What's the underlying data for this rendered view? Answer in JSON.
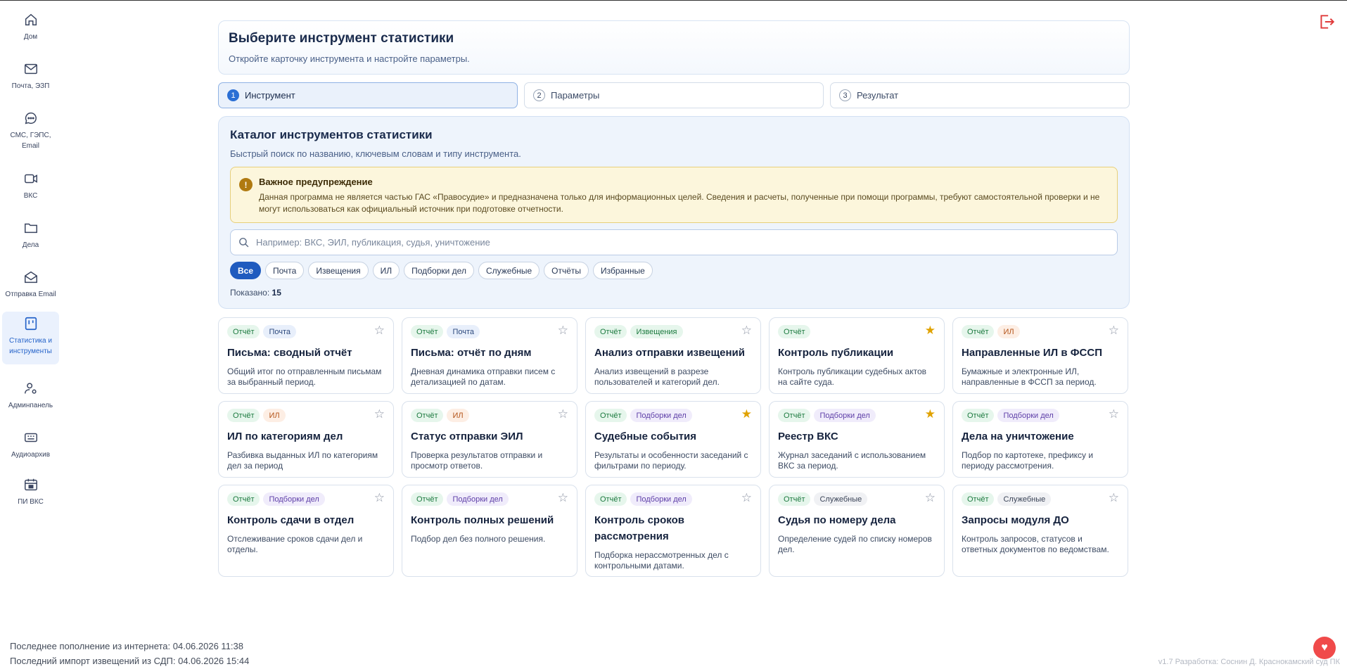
{
  "sidebar": {
    "items": [
      {
        "label": "Дом",
        "icon": "home-icon"
      },
      {
        "label": "Почта, ЭЗП",
        "icon": "mail-icon"
      },
      {
        "label": "СМС, ГЭПС, Email",
        "icon": "chat-icon"
      },
      {
        "label": "ВКС",
        "icon": "video-icon"
      },
      {
        "label": "Дела",
        "icon": "folder-icon"
      },
      {
        "label": "Отправка Email",
        "icon": "envelope-open-icon"
      },
      {
        "label": "Статистика и инструменты",
        "icon": "stats-icon",
        "active": true
      },
      {
        "label": "Админпанель",
        "icon": "user-gear-icon"
      },
      {
        "label": "Аудиоархив",
        "icon": "audio-icon"
      },
      {
        "label": "ПИ ВКС",
        "icon": "calendar-icon"
      }
    ]
  },
  "header": {
    "title": "Выберите инструмент статистики",
    "subtitle": "Откройте карточку инструмента и настройте параметры."
  },
  "steps": [
    {
      "num": "1",
      "label": "Инструмент",
      "active": true
    },
    {
      "num": "2",
      "label": "Параметры"
    },
    {
      "num": "3",
      "label": "Результат"
    }
  ],
  "catalog": {
    "title": "Каталог инструментов статистики",
    "subtitle": "Быстрый поиск по названию, ключевым словам и типу инструмента.",
    "warning_title": "Важное предупреждение",
    "warning_text": "Данная программа не является частью ГАС «Правосудие» и предназначена только для информационных целей. Сведения и расчеты, полученные при помощи программы, требуют самостоятельной проверки и не могут использоваться как официальный источник при подготовке отчетности.",
    "search_placeholder": "Например: ВКС, ЭИЛ, публикация, судья, уничтожение",
    "search_value": "",
    "filters": [
      "Все",
      "Почта",
      "Извещения",
      "ИЛ",
      "Подборки дел",
      "Служебные",
      "Отчёты",
      "Избранные"
    ],
    "active_filter": "Все",
    "shown_label": "Показано:",
    "shown_count": "15"
  },
  "tools": [
    {
      "tags": [
        [
          "Отчёт",
          "green"
        ],
        [
          "Почта",
          "blue"
        ]
      ],
      "title": "Письма: сводный отчёт",
      "desc": "Общий итог по отправленным письмам за выбранный период.",
      "fav": false
    },
    {
      "tags": [
        [
          "Отчёт",
          "green"
        ],
        [
          "Почта",
          "blue"
        ]
      ],
      "title": "Письма: отчёт по дням",
      "desc": "Дневная динамика отправки писем с детализацией по датам.",
      "fav": false
    },
    {
      "tags": [
        [
          "Отчёт",
          "green"
        ],
        [
          "Извещения",
          "green"
        ]
      ],
      "title": "Анализ отправки извещений",
      "desc": "Анализ извещений в разрезе пользователей и категорий дел.",
      "fav": false
    },
    {
      "tags": [
        [
          "Отчёт",
          "green"
        ]
      ],
      "title": "Контроль публикации",
      "desc": "Контроль публикации судебных актов на сайте суда.",
      "fav": true
    },
    {
      "tags": [
        [
          "Отчёт",
          "green"
        ],
        [
          "ИЛ",
          "orange"
        ]
      ],
      "title": "Направленные ИЛ в ФССП",
      "desc": "Бумажные и электронные ИЛ, направленные в ФССП за период.",
      "fav": false
    },
    {
      "tags": [
        [
          "Отчёт",
          "green"
        ],
        [
          "ИЛ",
          "orange"
        ]
      ],
      "title": "ИЛ по категориям дел",
      "desc": "Разбивка выданных ИЛ по категориям дел за период",
      "fav": false
    },
    {
      "tags": [
        [
          "Отчёт",
          "green"
        ],
        [
          "ИЛ",
          "orange"
        ]
      ],
      "title": "Статус отправки ЭИЛ",
      "desc": "Проверка результатов отправки и просмотр ответов.",
      "fav": false
    },
    {
      "tags": [
        [
          "Отчёт",
          "green"
        ],
        [
          "Подборки дел",
          "purple"
        ]
      ],
      "title": "Судебные события",
      "desc": "Результаты и особенности заседаний с фильтрами по периоду.",
      "fav": true
    },
    {
      "tags": [
        [
          "Отчёт",
          "green"
        ],
        [
          "Подборки дел",
          "purple"
        ]
      ],
      "title": "Реестр ВКС",
      "desc": "Журнал заседаний с использованием ВКС за период.",
      "fav": true
    },
    {
      "tags": [
        [
          "Отчёт",
          "green"
        ],
        [
          "Подборки дел",
          "purple"
        ]
      ],
      "title": "Дела на уничтожение",
      "desc": "Подбор по картотеке, префиксу и периоду рассмотрения.",
      "fav": false
    },
    {
      "tags": [
        [
          "Отчёт",
          "green"
        ],
        [
          "Подборки дел",
          "purple"
        ]
      ],
      "title": "Контроль сдачи в отдел",
      "desc": "Отслеживание сроков сдачи дел и отделы.",
      "fav": false
    },
    {
      "tags": [
        [
          "Отчёт",
          "green"
        ],
        [
          "Подборки дел",
          "purple"
        ]
      ],
      "title": "Контроль полных решений",
      "desc": "Подбор дел без полного решения.",
      "fav": false
    },
    {
      "tags": [
        [
          "Отчёт",
          "green"
        ],
        [
          "Подборки дел",
          "purple"
        ]
      ],
      "title": "Контроль сроков рассмотрения",
      "desc": "Подборка нерассмотренных дел с контрольными датами.",
      "fav": false
    },
    {
      "tags": [
        [
          "Отчёт",
          "green"
        ],
        [
          "Служебные",
          "grey"
        ]
      ],
      "title": "Судья по номеру дела",
      "desc": "Определение судей по списку номеров дел.",
      "fav": false
    },
    {
      "tags": [
        [
          "Отчёт",
          "green"
        ],
        [
          "Служебные",
          "grey"
        ]
      ],
      "title": "Запросы модуля ДО",
      "desc": "Контроль запросов, статусов и ответных документов по ведомствам.",
      "fav": false
    }
  ],
  "footer": {
    "line1": "Последнее пополнение из интернета: 04.06.2026 11:38",
    "line2": "Последний импорт извещений из СДП: 04.06.2026 15:44",
    "credit": "v1.7 Разработка: Соснин Д. Краснокамский суд ПК"
  },
  "colors": {
    "accent": "#2b6fd4",
    "star_on": "#e0a200",
    "logout": "#e03a3a",
    "heart": "#f04a4a"
  }
}
